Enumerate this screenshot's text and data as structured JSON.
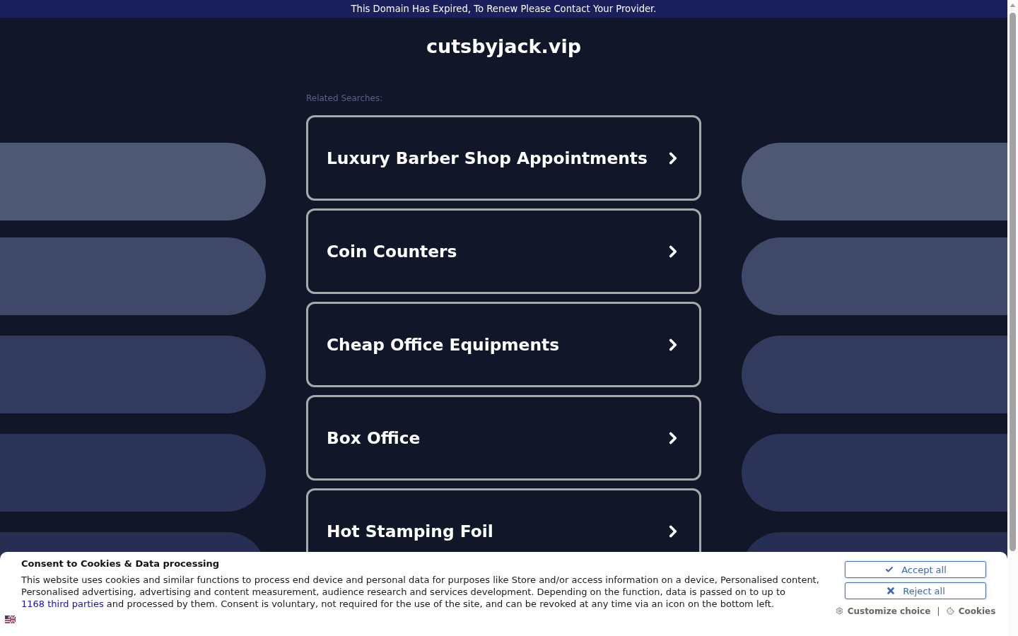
{
  "banner": {
    "text": "This Domain Has Expired, To Renew Please Contact Your Provider."
  },
  "domain": {
    "title": "cutsbyjack.vip"
  },
  "related": {
    "label": "Related Searches:",
    "items": [
      "Luxury Barber Shop Appointments",
      "Coin Counters",
      "Cheap Office Equipments",
      "Box Office",
      "Hot Stamping Foil"
    ]
  },
  "consent": {
    "title": "Consent to Cookies & Data processing",
    "text": "This website uses cookies and similar functions to process end device and personal data for purposes like Store and/or access information on a device, Personalised content, Personalised advertising, advertising and content measurement, audience research and services development. Depending on the function, data is passed on to up to",
    "link": "1168 third parties",
    "text_end": "and processed by them. Consent is voluntary, not required for the use of the site, and can be revoked at any time via an icon on the bottom left.",
    "buttons": [
      {
        "kind": "accept",
        "label": "Accept all"
      },
      {
        "kind": "reject",
        "label": "Reject all"
      }
    ],
    "links": [
      {
        "kind": "customize",
        "label": "Customize choice"
      },
      {
        "kind": "cookies",
        "label": "Cookies"
      }
    ],
    "separator": "|"
  }
}
